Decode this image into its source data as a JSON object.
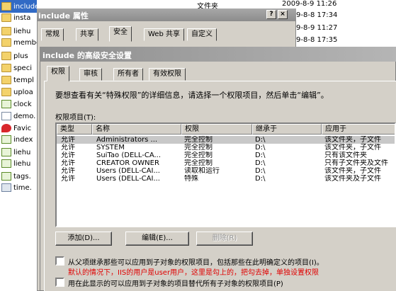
{
  "explorer": {
    "files": [
      {
        "name": "include",
        "icon": "folder-icon",
        "selected": true
      },
      {
        "name": "insta",
        "icon": "folder-icon"
      },
      {
        "name": "liehu",
        "icon": "folder-icon"
      },
      {
        "name": "membe",
        "icon": "folder-icon"
      },
      {
        "name": "plus",
        "icon": "folder-icon"
      },
      {
        "name": "speci",
        "icon": "folder-icon"
      },
      {
        "name": "templ",
        "icon": "folder-icon"
      },
      {
        "name": "uploa",
        "icon": "folder-icon"
      },
      {
        "name": "clock",
        "icon": "php-file-icon"
      },
      {
        "name": "demo.",
        "icon": "document-icon"
      },
      {
        "name": "Favic",
        "icon": "favicon-icon"
      },
      {
        "name": "index",
        "icon": "php-file-icon"
      },
      {
        "name": "liehu",
        "icon": "php-file-icon"
      },
      {
        "name": "liehu",
        "icon": "php-file-icon"
      },
      {
        "name": "tags.",
        "icon": "php-file-icon"
      },
      {
        "name": "time.",
        "icon": "image-file-icon"
      }
    ],
    "background_type": "文件夹",
    "background_dates": [
      "2009-8-9 11:26",
      "9-8-8 17:34",
      "9-8-9 11:27",
      "9-8-8 17:35"
    ]
  },
  "properties_dialog": {
    "title": "include 属性",
    "help_button": "?",
    "close_button": "×",
    "tabs": [
      "常规",
      "共享",
      "安全",
      "Web 共享",
      "自定义"
    ],
    "active_tab": "安全"
  },
  "advanced_dialog": {
    "title": "include 的高级安全设置",
    "tabs": [
      "权限",
      "审核",
      "所有者",
      "有效权限"
    ],
    "active_tab": "权限",
    "description": "要想查看有关“特殊权限”的详细信息，请选择一个权限项目，然后单击“编辑”。",
    "list_label": "权限项目(T):",
    "columns": [
      "类型",
      "名称",
      "权限",
      "继承于",
      "应用于"
    ],
    "rows": [
      {
        "type": "允许",
        "name": "Administrators ...",
        "permission": "完全控制",
        "inherited": "D:\\",
        "applies": "该文件夹，子文件",
        "selected": true
      },
      {
        "type": "允许",
        "name": "SYSTEM",
        "permission": "完全控制",
        "inherited": "D:\\",
        "applies": "该文件夹，子文件"
      },
      {
        "type": "允许",
        "name": "SuiTao (DELL-CA...",
        "permission": "完全控制",
        "inherited": "D:\\",
        "applies": "只有该文件夹"
      },
      {
        "type": "允许",
        "name": "CREATOR OWNER",
        "permission": "完全控制",
        "inherited": "D:\\",
        "applies": "只有子文件夹及文件"
      },
      {
        "type": "允许",
        "name": "Users (DELL-CAI...",
        "permission": "读取和运行",
        "inherited": "D:\\",
        "applies": "该文件夹，子文件"
      },
      {
        "type": "允许",
        "name": "Users (DELL-CAI...",
        "permission": "特殊",
        "inherited": "D:\\",
        "applies": "该文件夹及子文件"
      }
    ],
    "buttons": {
      "add": "添加(D)...",
      "edit": "编辑(E)...",
      "remove": "删除(R)"
    },
    "inherit_checkbox": "从父项继承那些可以应用到子对象的权限项目，包括那些在此明确定义的项目(I)。",
    "annotation": "默认的情况下，IIS的用户是user用户，这里是勾上的，把勾去掉，单独设置权限",
    "replace_checkbox": "用在此显示的可以应用到子对象的项目替代所有子对象的权限项目(P)"
  }
}
